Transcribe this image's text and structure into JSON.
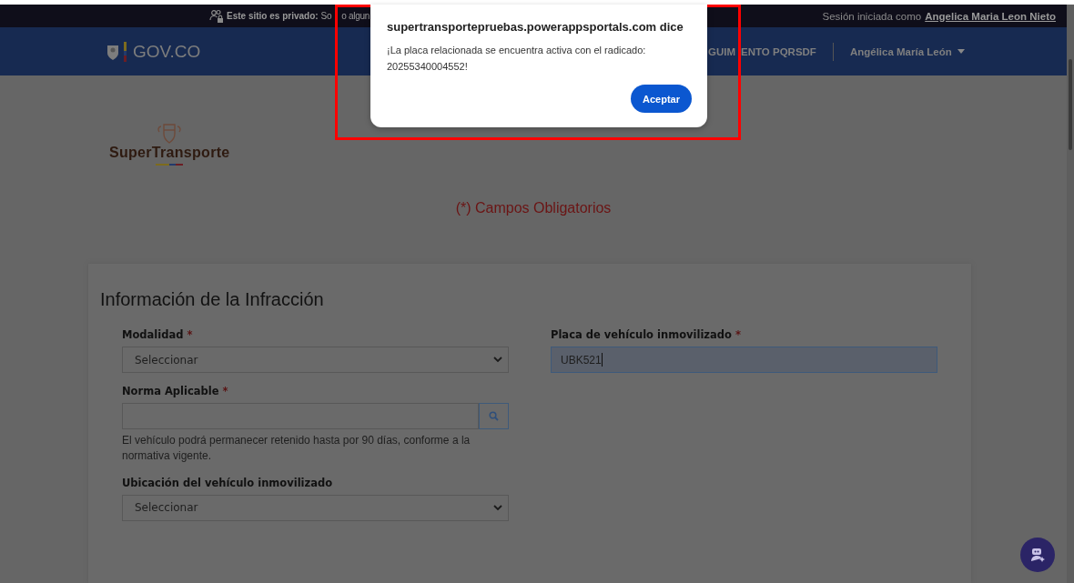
{
  "top_bar": {
    "privacy_label": "Este sitio es privado:",
    "privacy_text_parts": [
      "So",
      "o algun"
    ],
    "session_label": "Sesión iniciada como",
    "session_user": "Angelica Maria Leon Nieto"
  },
  "nav": {
    "brand": "GOV.CO",
    "item_parts": [
      "GUIM",
      "ENTO PQRSDF"
    ],
    "user_menu": "Angélica María León"
  },
  "logo": "SuperTransporte",
  "required_note": "(*) Campos Obligatorios",
  "form": {
    "title": "Información de la Infracción",
    "left": [
      {
        "kind": "select",
        "label": "Modalidad",
        "required_mark": "*",
        "value": "Seleccionar"
      },
      {
        "kind": "lookup",
        "label": "Norma Aplicable",
        "required_mark": "*",
        "hint": "El vehículo podrá permanecer retenido hasta por 90 días, conforme a la normativa vigente."
      },
      {
        "kind": "select",
        "label": "Ubicación del vehículo inmovilizado",
        "value": "Seleccionar"
      }
    ],
    "right": [
      {
        "kind": "text",
        "label": "Placa de vehículo inmovilizado",
        "required_mark": "*",
        "value": "UBK521",
        "focused": true
      }
    ]
  },
  "dialog": {
    "title": "supertransportepruebas.powerappsportals.com dice",
    "message": "¡La placa relacionada se encuentra activa con el radicado: 20255340004552!",
    "button": "Aceptar"
  }
}
